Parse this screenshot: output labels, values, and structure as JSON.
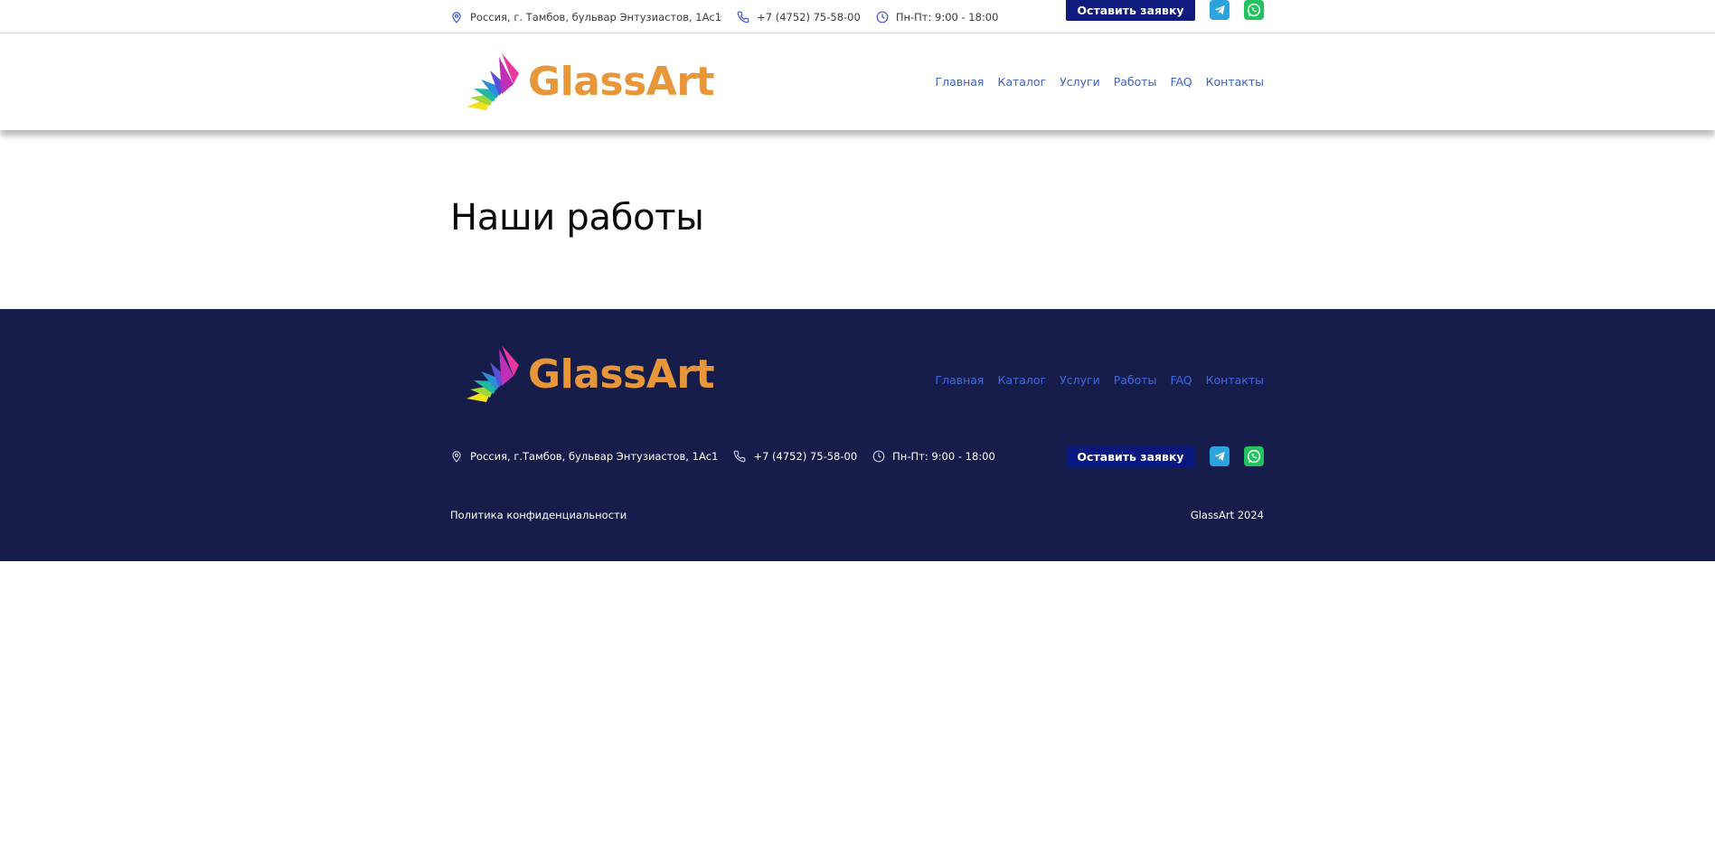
{
  "contacts": {
    "address": "Россия, г. Тамбов, бульвар Энтузиастов, 1Ас1",
    "phone": "+7 (4752) 75-58-00",
    "hours": "Пн-Пт: 9:00 - 18:00"
  },
  "cta_label": "Оставить заявку",
  "brand": {
    "name": "GlassArt",
    "accent": "#e8963a"
  },
  "nav": [
    "Главная",
    "Каталог",
    "Услуги",
    "Работы",
    "FAQ",
    "Контакты"
  ],
  "page": {
    "title": "Наши работы"
  },
  "footer": {
    "address": "Россия, г.Тамбов, бульвар Энтузиастов, 1Ас1",
    "phone": "+7 (4752) 75-58-00",
    "hours": "Пн-Пт: 9:00 - 18:00",
    "privacy": "Политика конфиденциальности",
    "copyright": "GlassArt 2024",
    "background": "#161d4a"
  },
  "social": {
    "telegram_icon": "telegram-icon",
    "whatsapp_icon": "whatsapp-icon",
    "telegram_color": "#2aa3df",
    "whatsapp_color": "#22c35e"
  },
  "icons": {
    "address": "map-pin-icon",
    "phone": "phone-icon",
    "hours": "clock-icon"
  }
}
